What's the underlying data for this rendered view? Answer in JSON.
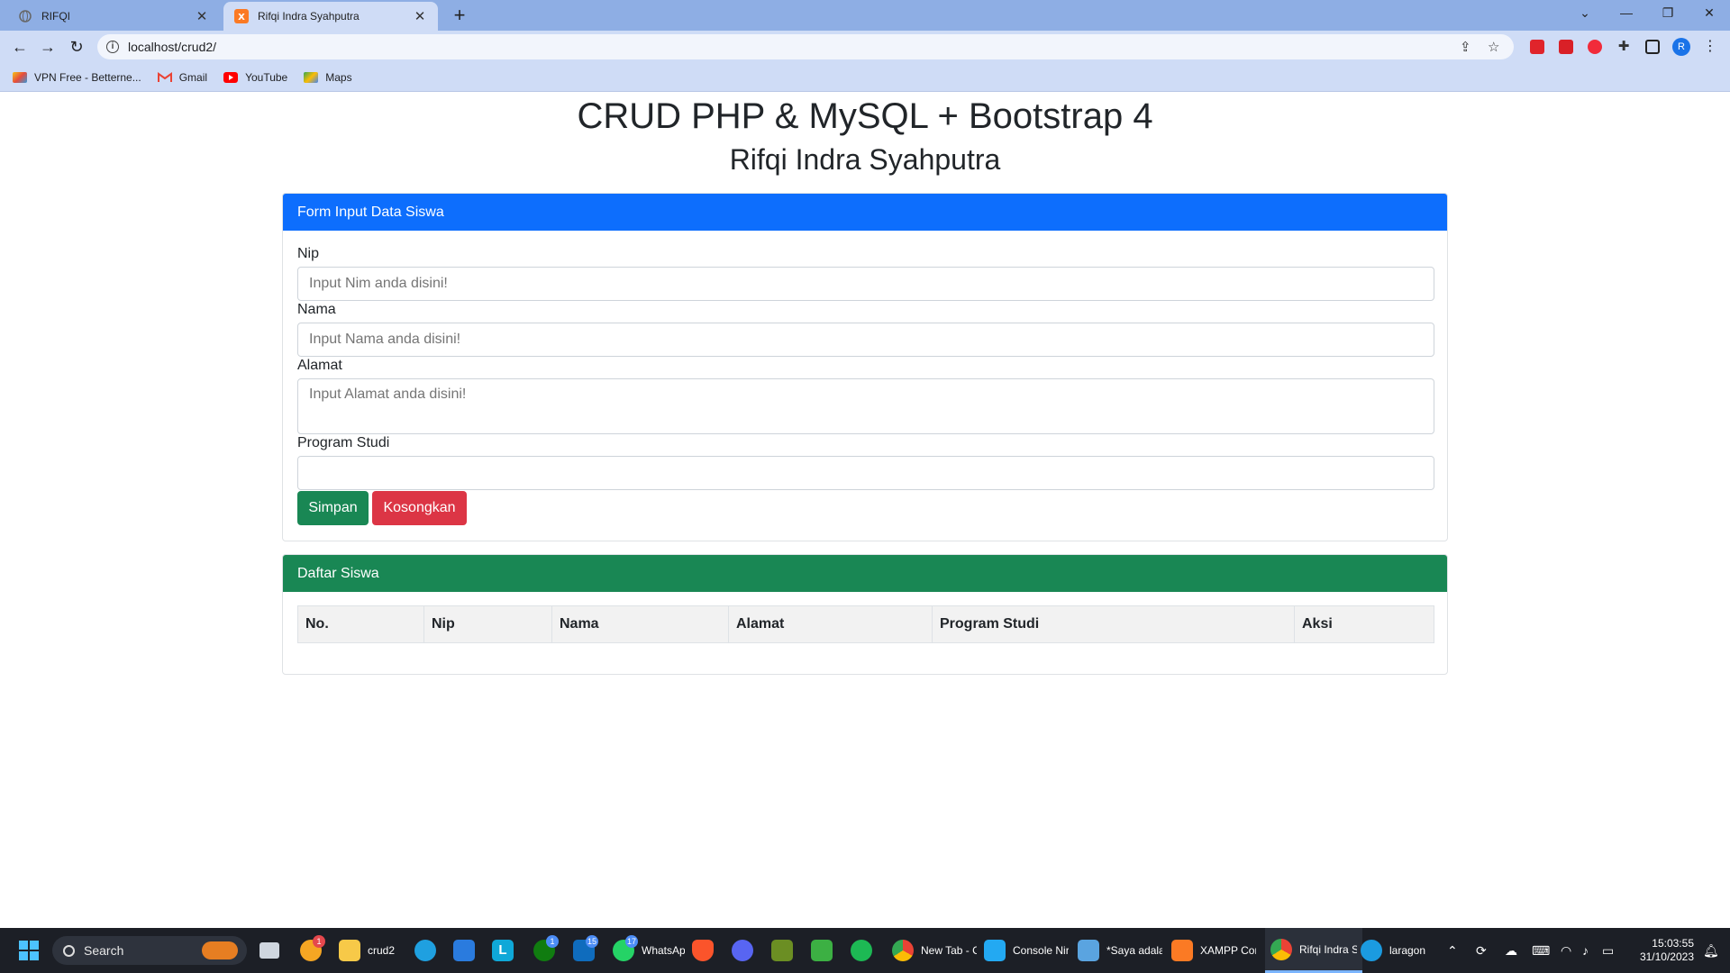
{
  "browser": {
    "tabs": [
      {
        "title": "RIFQI",
        "active": false
      },
      {
        "title": "Rifqi Indra Syahputra",
        "active": true
      }
    ],
    "url": "localhost/crud2/",
    "bookmarks": [
      {
        "label": "VPN Free - Betterne...",
        "icon": "vpn-icon"
      },
      {
        "label": "Gmail",
        "icon": "gmail-icon"
      },
      {
        "label": "YouTube",
        "icon": "youtube-icon"
      },
      {
        "label": "Maps",
        "icon": "maps-icon"
      }
    ],
    "profile_initial": "R"
  },
  "page": {
    "title": "CRUD PHP & MySQL + Bootstrap 4",
    "subtitle": "Rifqi Indra Syahputra",
    "form_card": {
      "header": "Form Input Data Siswa",
      "fields": {
        "nip": {
          "label": "Nip",
          "placeholder": "Input Nim anda disini!"
        },
        "nama": {
          "label": "Nama",
          "placeholder": "Input Nama anda disini!"
        },
        "alamat": {
          "label": "Alamat",
          "placeholder": "Input Alamat anda disini!"
        },
        "prodi": {
          "label": "Program Studi",
          "value": ""
        }
      },
      "buttons": {
        "save": "Simpan",
        "clear": "Kosongkan"
      }
    },
    "list_card": {
      "header": "Daftar Siswa",
      "columns": [
        "No.",
        "Nip",
        "Nama",
        "Alamat",
        "Program Studi",
        "Aksi"
      ]
    }
  },
  "taskbar": {
    "search_label": "Search",
    "apps": [
      {
        "label": "crud2",
        "icon": "folder-icon"
      },
      {
        "label": "WhatsApp",
        "icon": "whatsapp-icon",
        "badge": "17"
      },
      {
        "label": "New Tab - C",
        "icon": "chrome-icon"
      },
      {
        "label": "Console Nir",
        "icon": "vscode-icon"
      },
      {
        "label": "*Saya adala",
        "icon": "notepad-icon"
      },
      {
        "label": "XAMPP Cor",
        "icon": "xampp-icon"
      },
      {
        "label": "Rifqi Indra S",
        "icon": "chrome-icon"
      },
      {
        "label": "laragon",
        "icon": "laragon-icon"
      }
    ],
    "badges": {
      "widgets": "1",
      "xbox": "1",
      "mail": "15"
    },
    "clock": {
      "time": "15:03:55",
      "date": "31/10/2023"
    }
  }
}
